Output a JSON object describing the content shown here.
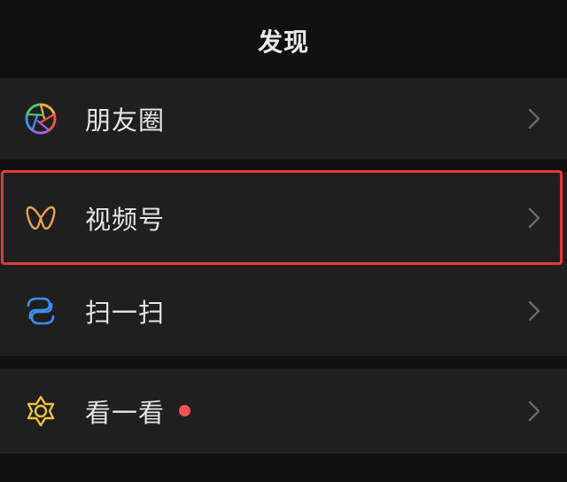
{
  "header": {
    "title": "发现"
  },
  "items": [
    {
      "label": "朋友圈",
      "icon": "moments-aperture-icon"
    },
    {
      "label": "视频号",
      "icon": "channels-icon",
      "highlighted": true,
      "highlight_color": "#e23a3a"
    },
    {
      "label": "扫一扫",
      "icon": "scan-icon"
    },
    {
      "label": "看一看",
      "icon": "top-stories-icon",
      "badge": "red-dot",
      "badge_color": "#ef5350"
    }
  ],
  "colors": {
    "background": "#111111",
    "row_background": "#1f1f1f",
    "text": "#e6e6e6",
    "channels_accent": "#e6a15a",
    "scan_accent": "#3d8ef0",
    "top_stories_accent": "#f0c23b"
  }
}
